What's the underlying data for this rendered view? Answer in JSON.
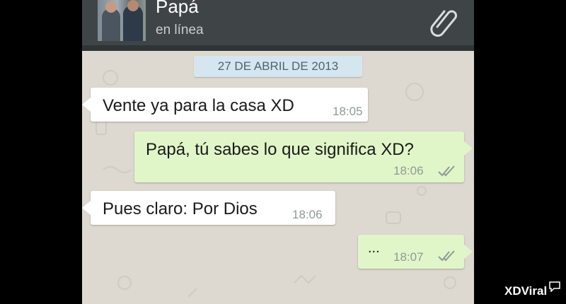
{
  "header": {
    "contact_name": "Papá",
    "status": "en línea",
    "attach_icon": "paperclip-icon"
  },
  "date_chip": "27 DE ABRIL DE 2013",
  "messages": [
    {
      "direction": "in",
      "text": "Vente ya para la casa XD",
      "time": "18:05"
    },
    {
      "direction": "out",
      "text": "Papá, tú sabes lo que significa XD?",
      "time": "18:06",
      "read_ticks": "double-check-icon"
    },
    {
      "direction": "in",
      "text": "Pues claro: Por Dios",
      "time": "18:06"
    },
    {
      "direction": "out",
      "text": "...",
      "time": "18:07",
      "read_ticks": "double-check-icon"
    }
  ],
  "watermark": "XDViral",
  "colors": {
    "header": "#3f4447",
    "chat_background": "#ddd8d0",
    "incoming_bubble": "#ffffff",
    "outgoing_bubble": "#e1f6c8",
    "date_chip": "#d6e6ee"
  }
}
